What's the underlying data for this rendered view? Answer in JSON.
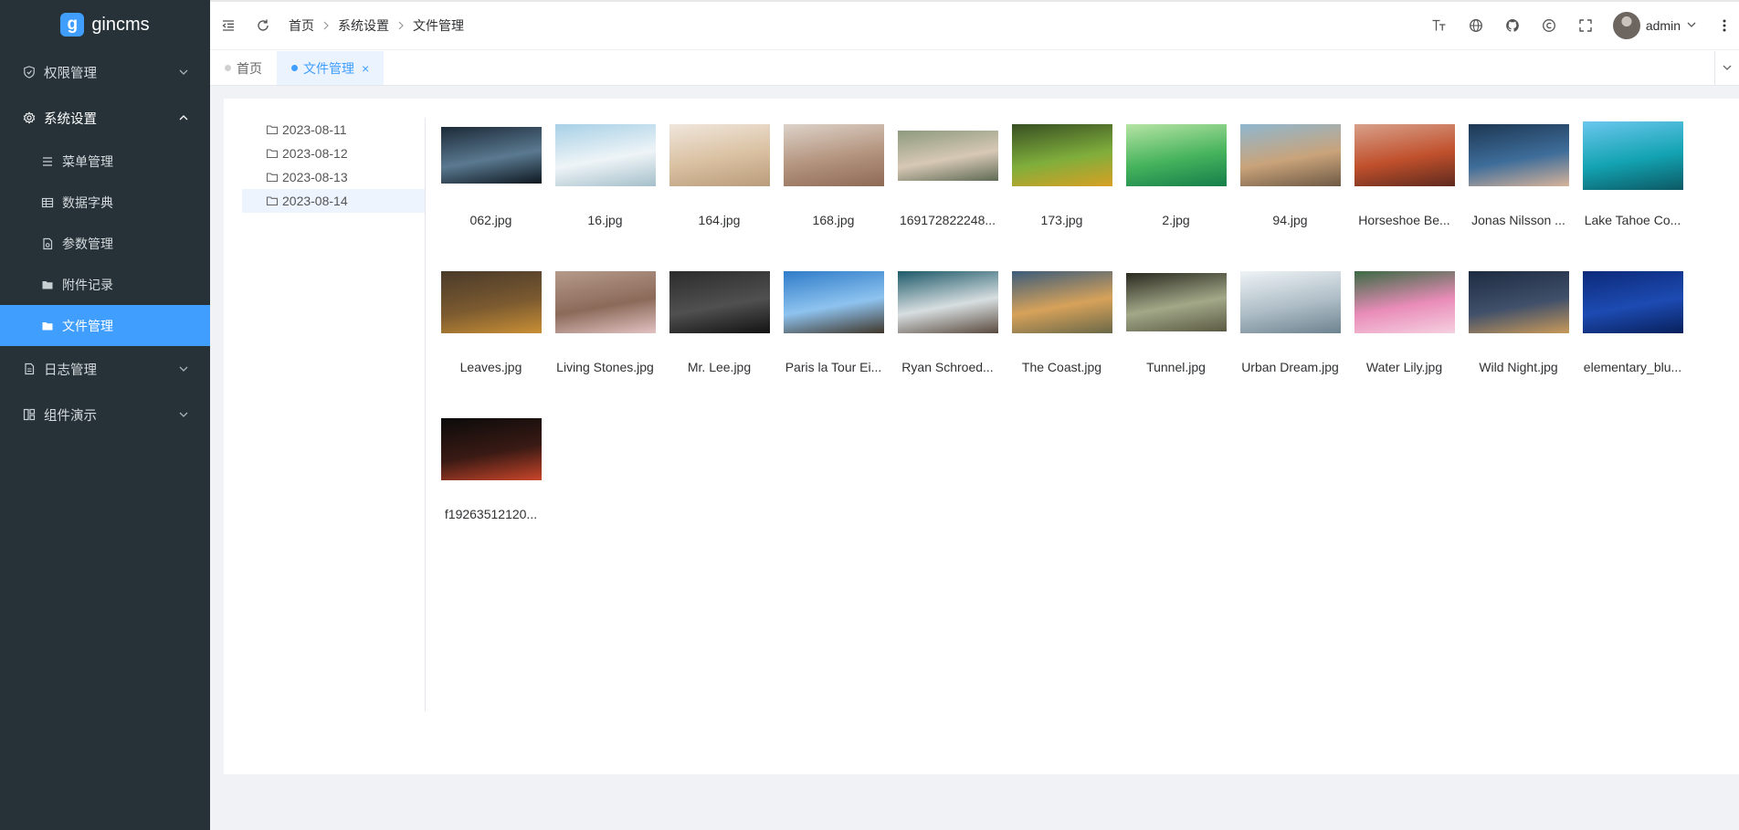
{
  "app": {
    "logo_letter": "g",
    "name": "gincms"
  },
  "sidebar": {
    "items": [
      {
        "label": "权限管理",
        "icon": "shield-icon",
        "expanded": false
      },
      {
        "label": "系统设置",
        "icon": "gear-icon",
        "expanded": true,
        "children": [
          {
            "label": "菜单管理",
            "icon": "list-icon"
          },
          {
            "label": "数据字典",
            "icon": "table-icon"
          },
          {
            "label": "参数管理",
            "icon": "document-settings-icon"
          },
          {
            "label": "附件记录",
            "icon": "folder-icon"
          },
          {
            "label": "文件管理",
            "icon": "folder-icon",
            "active": true
          }
        ]
      },
      {
        "label": "日志管理",
        "icon": "log-icon",
        "expanded": false
      },
      {
        "label": "组件演示",
        "icon": "components-icon",
        "expanded": false
      }
    ]
  },
  "header": {
    "breadcrumb": [
      "首页",
      "系统设置",
      "文件管理"
    ],
    "user": "admin",
    "tools": [
      "font-size-icon",
      "globe-icon",
      "github-icon",
      "copyright-icon",
      "fullscreen-icon"
    ]
  },
  "tabs": [
    {
      "label": "首页",
      "active": false
    },
    {
      "label": "文件管理",
      "active": true,
      "close": "×"
    }
  ],
  "tree": {
    "folders": [
      "2023-08-11",
      "2023-08-12",
      "2023-08-13",
      "2023-08-14"
    ],
    "selected": "2023-08-14"
  },
  "files": [
    {
      "name": "062.jpg",
      "ratio": 0.56,
      "colors": [
        "#1c2a38",
        "#5a7990",
        "#0e1820"
      ]
    },
    {
      "name": "16.jpg",
      "ratio": 0.62,
      "colors": [
        "#a7d0e6",
        "#eef4f7",
        "#a5bfca"
      ]
    },
    {
      "name": "164.jpg",
      "ratio": 0.62,
      "colors": [
        "#f0e6dc",
        "#d9c0a0",
        "#b99c7c"
      ]
    },
    {
      "name": "168.jpg",
      "ratio": 0.62,
      "colors": [
        "#ddd2c9",
        "#b3937d",
        "#8e6a55"
      ]
    },
    {
      "name": "169172822248...",
      "ratio": 0.5,
      "colors": [
        "#8d9a7e",
        "#d7c8b5",
        "#5e6a54"
      ]
    },
    {
      "name": "173.jpg",
      "ratio": 0.62,
      "colors": [
        "#384f22",
        "#7fae3c",
        "#d8a024"
      ]
    },
    {
      "name": "2.jpg",
      "ratio": 0.62,
      "colors": [
        "#b6e4a4",
        "#46b35d",
        "#157e4a"
      ]
    },
    {
      "name": "94.jpg",
      "ratio": 0.62,
      "colors": [
        "#8fb7cf",
        "#c9a37a",
        "#6e5a45"
      ]
    },
    {
      "name": "Horseshoe Be...",
      "ratio": 0.62,
      "colors": [
        "#d8a08a",
        "#c0502c",
        "#5e2a1e"
      ]
    },
    {
      "name": "Jonas Nilsson ...",
      "ratio": 0.62,
      "colors": [
        "#1d3753",
        "#3e6d9a",
        "#d7b39a"
      ]
    },
    {
      "name": "Lake Tahoe Co...",
      "ratio": 0.68,
      "colors": [
        "#6bc7ee",
        "#13a3b2",
        "#0c5964"
      ]
    },
    {
      "name": "Leaves.jpg",
      "ratio": 0.62,
      "colors": [
        "#4a3a2a",
        "#7b5a30",
        "#c98f35"
      ]
    },
    {
      "name": "Living Stones.jpg",
      "ratio": 0.62,
      "colors": [
        "#b59a8a",
        "#8c6a5a",
        "#e2c2c2"
      ]
    },
    {
      "name": "Mr. Lee.jpg",
      "ratio": 0.62,
      "colors": [
        "#2c2c2c",
        "#505050",
        "#121212"
      ]
    },
    {
      "name": "Paris la Tour Ei...",
      "ratio": 0.62,
      "colors": [
        "#2f7cc9",
        "#8ec3ef",
        "#40362a"
      ]
    },
    {
      "name": "Ryan Schroed...",
      "ratio": 0.62,
      "colors": [
        "#1d5a6a",
        "#d7dee0",
        "#5a4a3e"
      ]
    },
    {
      "name": "The Coast.jpg",
      "ratio": 0.62,
      "colors": [
        "#3c5c7a",
        "#d7a25a",
        "#6a6848"
      ]
    },
    {
      "name": "Tunnel.jpg",
      "ratio": 0.58,
      "colors": [
        "#2a2a20",
        "#a3a888",
        "#5a5a44"
      ]
    },
    {
      "name": "Urban Dream.jpg",
      "ratio": 0.62,
      "colors": [
        "#eef3f6",
        "#aebdc6",
        "#6d8390"
      ]
    },
    {
      "name": "Water Lily.jpg",
      "ratio": 0.62,
      "colors": [
        "#3b6a44",
        "#e98cb8",
        "#f5d0e0"
      ]
    },
    {
      "name": "Wild Night.jpg",
      "ratio": 0.62,
      "colors": [
        "#1d2b42",
        "#41506a",
        "#c99a5a"
      ]
    },
    {
      "name": "elementary_blu...",
      "ratio": 0.62,
      "colors": [
        "#0c2a7a",
        "#1d4bb2",
        "#08205c"
      ]
    },
    {
      "name": "f19263512120...",
      "ratio": 0.62,
      "colors": [
        "#0b0b0b",
        "#3a1a14",
        "#c9452a"
      ]
    }
  ]
}
